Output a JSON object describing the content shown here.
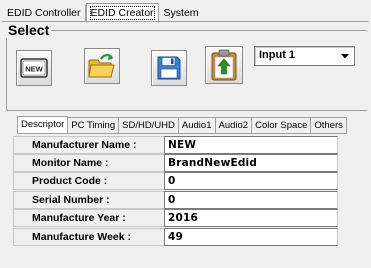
{
  "top_tabs": [
    "EDID Controller",
    "EDID Creator",
    "System"
  ],
  "select_group": {
    "title": "Select",
    "buttons": [
      {
        "name": "new-button",
        "icon": "new-file-icon",
        "icon_text": "NEW"
      },
      {
        "name": "open-button",
        "icon": "open-folder-icon"
      },
      {
        "name": "save-button",
        "icon": "floppy-disk-icon"
      },
      {
        "name": "import-button",
        "icon": "clipboard-upload-icon"
      }
    ],
    "input_select": {
      "value": "Input 1"
    }
  },
  "sub_tabs": [
    "Descriptor",
    "PC Timing",
    "SD/HD/UHD",
    "Audio1",
    "Audio2",
    "Color Space",
    "Others"
  ],
  "fields": [
    {
      "label": "Manufacturer Name :",
      "value": "NEW"
    },
    {
      "label": "Monitor Name :",
      "value": "BrandNewEdid"
    },
    {
      "label": "Product Code :",
      "value": "0"
    },
    {
      "label": "Serial Number :",
      "value": "0"
    },
    {
      "label": "Manufacture Year :",
      "value": "2016"
    },
    {
      "label": "Manufacture Week :",
      "value": "49"
    }
  ],
  "colors": {
    "window_bg": "#f0f0f0",
    "border": "#a0a0a0",
    "field_bg": "#ffffff"
  }
}
